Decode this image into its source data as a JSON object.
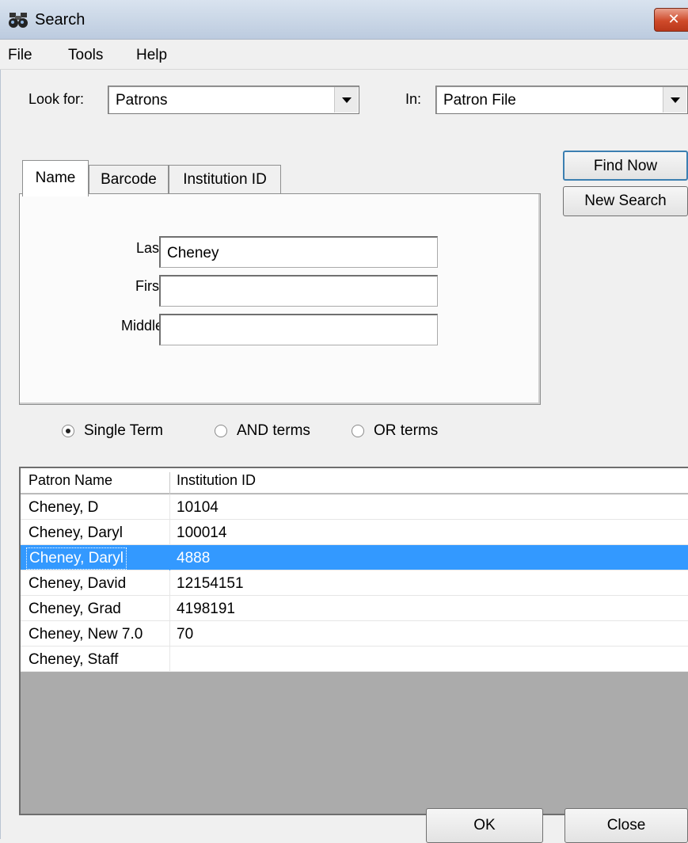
{
  "window": {
    "title": "Search",
    "icon": "binoculars-icon",
    "close_label": "✕"
  },
  "menu": [
    "File",
    "Tools",
    "Help"
  ],
  "look_for": {
    "label": "Look for:",
    "value": "Patrons"
  },
  "in": {
    "label": "In:",
    "value": "Patron File"
  },
  "buttons": {
    "find_now": "Find Now",
    "new_search": "New Search",
    "ok": "OK",
    "close": "Close"
  },
  "tabs": [
    {
      "label": "Name",
      "active": true
    },
    {
      "label": "Barcode",
      "active": false
    },
    {
      "label": "Institution ID",
      "active": false
    }
  ],
  "fields": {
    "last": {
      "label": "Last:",
      "value": "Cheney"
    },
    "first": {
      "label": "First:",
      "value": ""
    },
    "middle": {
      "label": "Middle:",
      "value": ""
    }
  },
  "radios": [
    {
      "label": "Single Term",
      "selected": true
    },
    {
      "label": "AND terms",
      "selected": false
    },
    {
      "label": "OR terms",
      "selected": false
    }
  ],
  "results": {
    "columns": [
      "Patron Name",
      "Institution ID"
    ],
    "rows": [
      {
        "name": "Cheney, D",
        "id": "10104",
        "selected": false
      },
      {
        "name": "Cheney, Daryl",
        "id": "100014",
        "selected": false
      },
      {
        "name": "Cheney, Daryl",
        "id": "4888",
        "selected": true
      },
      {
        "name": "Cheney, David",
        "id": "12154151",
        "selected": false
      },
      {
        "name": "Cheney, Grad",
        "id": "4198191",
        "selected": false
      },
      {
        "name": "Cheney, New 7.0",
        "id": "70",
        "selected": false
      },
      {
        "name": "Cheney, Staff",
        "id": "",
        "selected": false
      }
    ]
  },
  "colors": {
    "selection": "#3399ff",
    "grid_empty": "#ababab",
    "window_bg": "#f0f0f0"
  }
}
